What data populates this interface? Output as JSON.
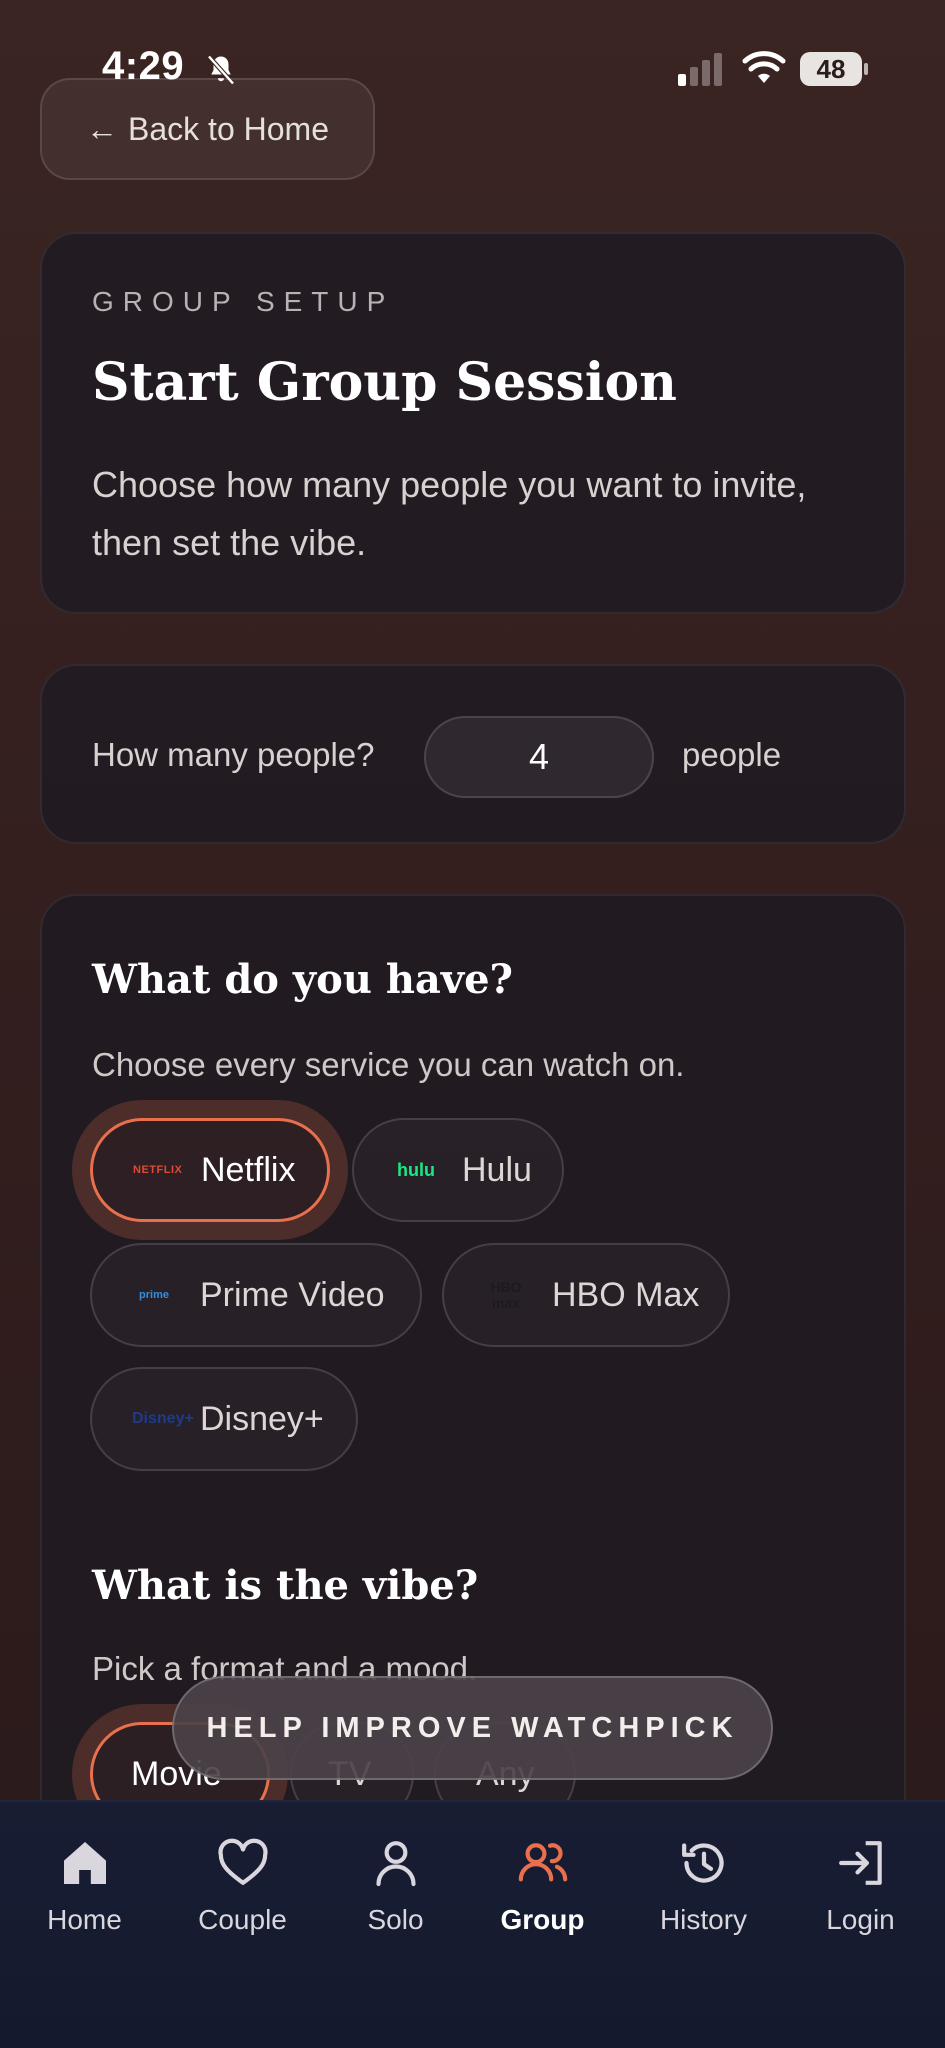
{
  "status_bar": {
    "time": "4:29",
    "battery": "48"
  },
  "header": {
    "back_label": "Back to Home"
  },
  "setup": {
    "eyebrow": "GROUP SETUP",
    "title": "Start Group Session",
    "description": "Choose how many people you want to invite, then set the vibe."
  },
  "people": {
    "label": "How many people?",
    "value": "4",
    "suffix": "people"
  },
  "services": {
    "title": "What do you have?",
    "description": "Choose every service you can watch on.",
    "items": [
      {
        "label": "Netflix",
        "logo": "NETFLIX",
        "selected": true
      },
      {
        "label": "Hulu",
        "logo": "hulu",
        "selected": false
      },
      {
        "label": "Prime Video",
        "logo": "prime",
        "selected": false
      },
      {
        "label": "HBO Max",
        "logo": "HBO max",
        "selected": false
      },
      {
        "label": "Disney+",
        "logo": "Disney+",
        "selected": false
      }
    ]
  },
  "vibe": {
    "title": "What is the vibe?",
    "description": "Pick a format and a mood.",
    "formats": [
      {
        "label": "Movie",
        "selected": true
      },
      {
        "label": "TV",
        "selected": false
      },
      {
        "label": "Any",
        "selected": false
      }
    ]
  },
  "banner": {
    "label": "HELP IMPROVE WATCHPICK"
  },
  "tabs": [
    {
      "label": "Home",
      "icon": "home-icon"
    },
    {
      "label": "Couple",
      "icon": "heart-icon"
    },
    {
      "label": "Solo",
      "icon": "person-icon"
    },
    {
      "label": "Group",
      "icon": "group-icon",
      "active": true
    },
    {
      "label": "History",
      "icon": "history-icon"
    },
    {
      "label": "Login",
      "icon": "login-icon"
    }
  ],
  "colors": {
    "accent": "#e9704c",
    "background": "#35201f",
    "card": "#1e1a22",
    "tabbar": "#161b30"
  }
}
